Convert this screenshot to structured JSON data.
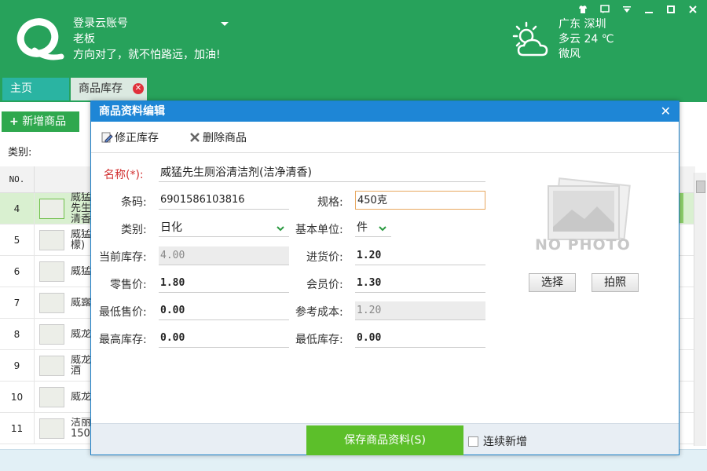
{
  "header": {
    "account_label": "登录云账号",
    "user_name": "老板",
    "slogan": "方向对了，就不怕路远，加油!",
    "weather": {
      "location": "广东 深圳",
      "condition": "多云 24 ℃",
      "wind": "微风"
    }
  },
  "window_controls": [
    "skin-icon",
    "feedback-icon",
    "menu-icon",
    "minimize-icon",
    "maximize-icon",
    "close-icon"
  ],
  "tabs": [
    {
      "label": "主页",
      "active": false
    },
    {
      "label": "商品库存",
      "active": true
    }
  ],
  "list_page": {
    "add_button": "新增商品",
    "category_label": "类别:",
    "column_no": "NO.",
    "rows": [
      {
        "no": "4",
        "name": "威猛先生 清香",
        "selected": true
      },
      {
        "no": "5",
        "name": "威猛 檬)",
        "selected": false
      },
      {
        "no": "6",
        "name": "威猛",
        "selected": false
      },
      {
        "no": "7",
        "name": "威露",
        "selected": false
      },
      {
        "no": "8",
        "name": "威龙",
        "selected": false
      },
      {
        "no": "9",
        "name": "威龙 酒",
        "selected": false
      },
      {
        "no": "10",
        "name": "威龙",
        "selected": false
      },
      {
        "no": "11",
        "name": "洁丽 150",
        "selected": false
      }
    ]
  },
  "dialog": {
    "title": "商品资料编辑",
    "toolbar": {
      "fix_stock": "修正库存",
      "delete": "删除商品"
    },
    "fields": {
      "name_label": "名称(*):",
      "name_value": "威猛先生厕浴清洁剂(洁净清香)",
      "barcode_label": "条码:",
      "barcode_value": "6901586103816",
      "spec_label": "规格:",
      "spec_value": "450克",
      "category_label": "类别:",
      "category_value": "日化",
      "unit_label": "基本单位:",
      "unit_value": "件",
      "stock_label": "当前库存:",
      "stock_value": "4.00",
      "purchase_label": "进货价:",
      "purchase_value": "1.20",
      "retail_label": "零售价:",
      "retail_value": "1.80",
      "member_label": "会员价:",
      "member_value": "1.30",
      "min_price_label": "最低售价:",
      "min_price_value": "0.00",
      "ref_cost_label": "参考成本:",
      "ref_cost_value": "1.20",
      "max_stock_label": "最高库存:",
      "max_stock_value": "0.00",
      "min_stock_label": "最低库存:",
      "min_stock_value": "0.00"
    },
    "photo": {
      "placeholder": "NO PHOTO",
      "select_button": "选择",
      "capture_button": "拍照"
    },
    "footer": {
      "save_button": "保存商品资料(S)",
      "continue_label": "连续新增"
    }
  },
  "colors": {
    "header_green": "#27a25b",
    "dialog_blue": "#1e86d6",
    "save_green": "#5cbf2a",
    "required_red": "#d23030"
  }
}
